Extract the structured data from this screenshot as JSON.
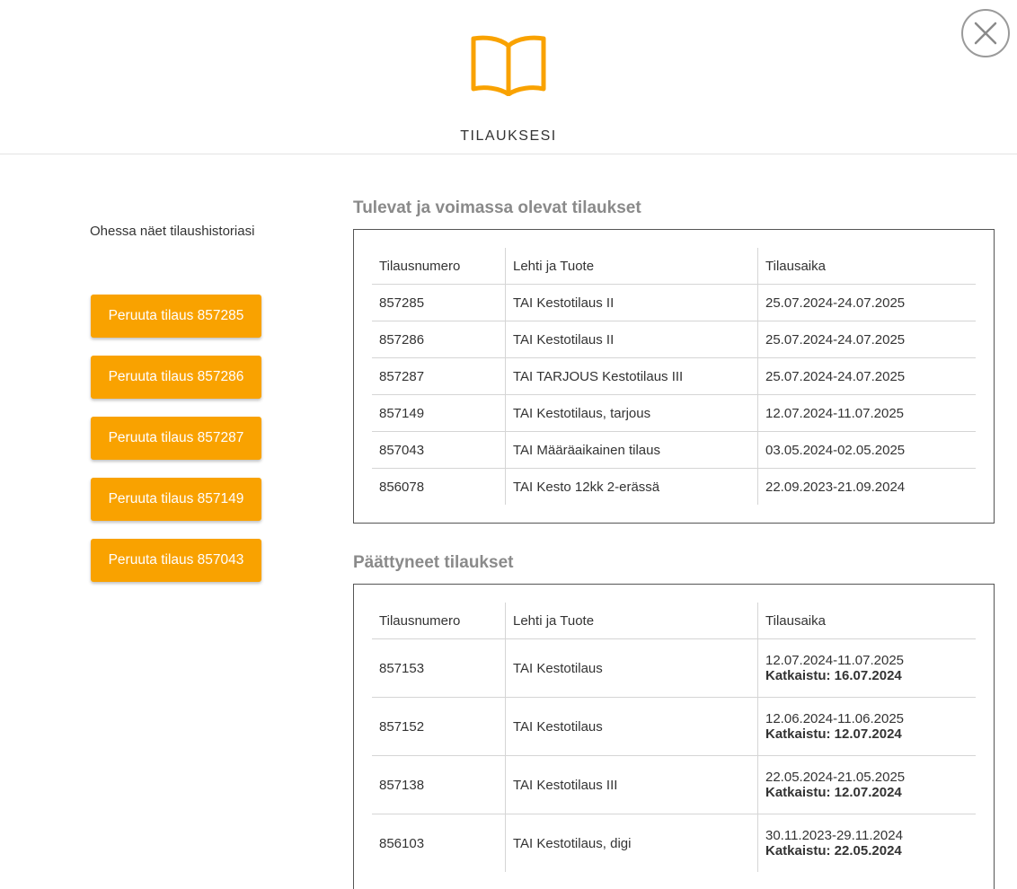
{
  "header": {
    "title": "TILAUKSESI",
    "icon": "book-icon",
    "accent": "#f9a200"
  },
  "close": {
    "icon": "close-icon"
  },
  "intro": "Ohessa näet tilaushistoriasi",
  "cancel_buttons": [
    "Peruuta tilaus 857285",
    "Peruuta tilaus 857286",
    "Peruuta tilaus 857287",
    "Peruuta tilaus 857149",
    "Peruuta tilaus 857043"
  ],
  "current": {
    "title": "Tulevat ja voimassa olevat tilaukset",
    "headers": [
      "Tilausnumero",
      "Lehti ja Tuote",
      "Tilausaika"
    ],
    "rows": [
      [
        "857285",
        "TAI Kestotilaus II",
        "25.07.2024-24.07.2025"
      ],
      [
        "857286",
        "TAI Kestotilaus II",
        "25.07.2024-24.07.2025"
      ],
      [
        "857287",
        "TAI TARJOUS Kestotilaus III",
        "25.07.2024-24.07.2025"
      ],
      [
        "857149",
        "TAI Kestotilaus, tarjous",
        "12.07.2024-11.07.2025"
      ],
      [
        "857043",
        "TAI Määräaikainen tilaus",
        "03.05.2024-02.05.2025"
      ],
      [
        "856078",
        "TAI Kesto 12kk 2-erässä",
        "22.09.2023-21.09.2024"
      ]
    ]
  },
  "ended": {
    "title": "Päättyneet tilaukset",
    "headers": [
      "Tilausnumero",
      "Lehti ja Tuote",
      "Tilausaika"
    ],
    "rows": [
      [
        "857153",
        "TAI Kestotilaus",
        "12.07.2024-11.07.2025",
        "Katkaistu: 16.07.2024"
      ],
      [
        "857152",
        "TAI Kestotilaus",
        "12.06.2024-11.06.2025",
        "Katkaistu: 12.07.2024"
      ],
      [
        "857138",
        "TAI Kestotilaus III",
        "22.05.2024-21.05.2025",
        "Katkaistu: 12.07.2024"
      ],
      [
        "856103",
        "TAI Kestotilaus, digi",
        "30.11.2023-29.11.2024",
        "Katkaistu: 22.05.2024"
      ]
    ]
  }
}
